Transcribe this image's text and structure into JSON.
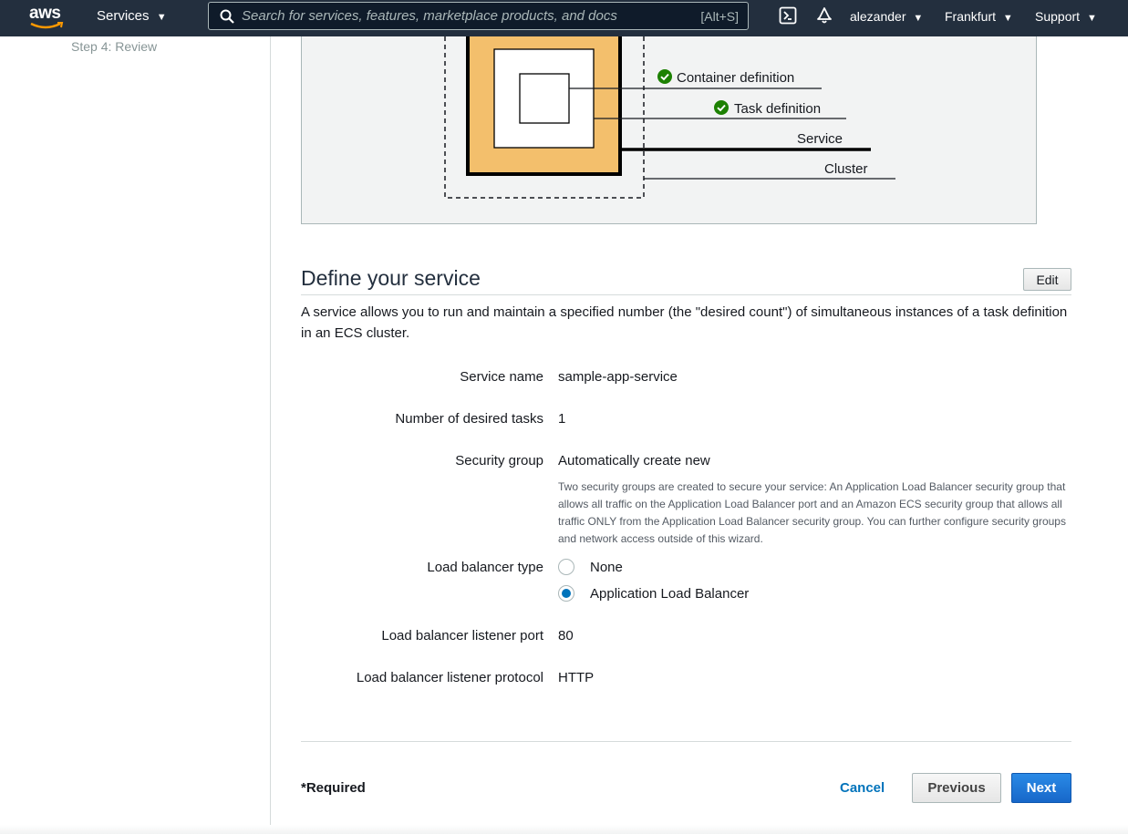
{
  "nav": {
    "logo": "aws",
    "services_label": "Services",
    "search_placeholder": "Search for services, features, marketplace products, and docs",
    "search_shortcut": "[Alt+S]",
    "user": "alezander",
    "region": "Frankfurt",
    "support": "Support",
    "caret": "▼"
  },
  "sidebar": {
    "steps": [
      {
        "label": "Step 4: Review"
      }
    ]
  },
  "diagram": {
    "labels": {
      "container_definition": "Container definition",
      "task_definition": "Task definition",
      "service": "Service",
      "cluster": "Cluster"
    },
    "colors": {
      "task_fill": "#f3bf6c",
      "check": "#1d8102"
    }
  },
  "section": {
    "title": "Define your service",
    "edit_label": "Edit",
    "description": "A service allows you to run and maintain a specified number (the \"desired count\") of simultaneous instances of a task definition in an ECS cluster."
  },
  "fields": {
    "service_name": {
      "label": "Service name",
      "value": "sample-app-service"
    },
    "desired_tasks": {
      "label": "Number of desired tasks",
      "value": "1"
    },
    "security_group": {
      "label": "Security group",
      "value": "Automatically create new",
      "help": "Two security groups are created to secure your service: An Application Load Balancer security group that allows all traffic on the Application Load Balancer port and an Amazon ECS security group that allows all traffic ONLY from the Application Load Balancer security group. You can further configure security groups and network access outside of this wizard."
    },
    "lb_type": {
      "label": "Load balancer type",
      "options": [
        {
          "label": "None",
          "selected": false
        },
        {
          "label": "Application Load Balancer",
          "selected": true
        }
      ]
    },
    "listener_port": {
      "label": "Load balancer listener port",
      "value": "80"
    },
    "listener_protocol": {
      "label": "Load balancer listener protocol",
      "value": "HTTP"
    }
  },
  "footer": {
    "required": "*Required",
    "cancel": "Cancel",
    "previous": "Previous",
    "next": "Next"
  },
  "colors": {
    "nav_bg": "#232f3e",
    "primary": "#1767c9",
    "link": "#0073bb"
  }
}
